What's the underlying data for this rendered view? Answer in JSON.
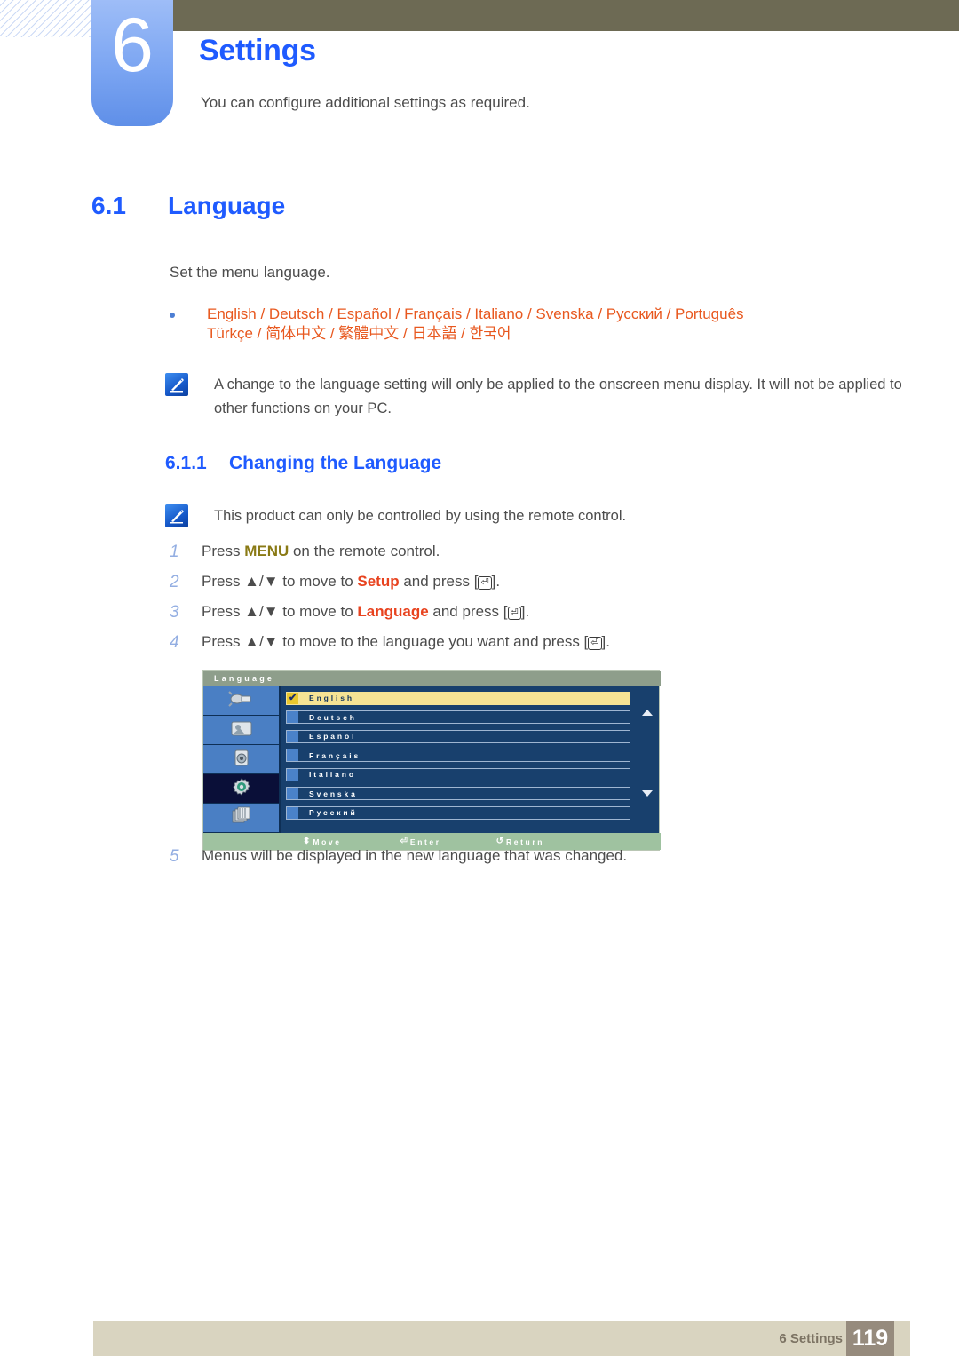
{
  "chapter": {
    "number": "6",
    "title": "Settings",
    "subtitle": "You can configure additional settings as required."
  },
  "section": {
    "number": "6.1",
    "title": "Language",
    "intro": "Set the menu language."
  },
  "language_bullet": {
    "line1": "English / Deutsch / Español / Français / Italiano / Svenska / Русский / Português",
    "line2": "Türkçe / 简体中文 / 繁體中文 / 日本語 / 한국어"
  },
  "notes": {
    "language_note": "A change to the language setting will only be applied to the onscreen menu display. It will not be applied to other functions on your PC.",
    "remote_note": "This product can only be controlled by using the remote control."
  },
  "subsection": {
    "number": "6.1.1",
    "title": "Changing the Language"
  },
  "steps": [
    {
      "num": "1",
      "pre": "Press ",
      "kw": "MENU",
      "kw_style": "menu",
      "post": " on the remote control.",
      "has_enter": false
    },
    {
      "num": "2",
      "pre": "Press ▲/▼ to move to ",
      "kw": "Setup",
      "kw_style": "orange",
      "post": " and press [",
      "has_enter": true,
      "tail": "]."
    },
    {
      "num": "3",
      "pre": "Press ▲/▼ to move to ",
      "kw": "Language",
      "kw_style": "orange",
      "post": " and press [",
      "has_enter": true,
      "tail": "]."
    },
    {
      "num": "4",
      "pre": "Press ▲/▼ to move to the language you want and press [",
      "kw": "",
      "kw_style": "",
      "post": "",
      "has_enter": true,
      "tail": "]."
    }
  ],
  "step5": {
    "num": "5",
    "text": "Menus will be displayed in the new language that was changed."
  },
  "osd": {
    "title": "Language",
    "sidebar_icons": [
      "input-connector-icon",
      "picture-icon",
      "sound-speaker-icon",
      "setup-gear-icon",
      "multi-control-icon"
    ],
    "selected_sidebar_index": 3,
    "options": [
      {
        "label": "English",
        "selected": true,
        "check": "✔"
      },
      {
        "label": "Deutsch",
        "selected": false,
        "check": ""
      },
      {
        "label": "Español",
        "selected": false,
        "check": ""
      },
      {
        "label": "Français",
        "selected": false,
        "check": ""
      },
      {
        "label": "Italiano",
        "selected": false,
        "check": ""
      },
      {
        "label": "Svenska",
        "selected": false,
        "check": ""
      },
      {
        "label": "Русский",
        "selected": false,
        "check": ""
      }
    ],
    "footer": {
      "move": "Move",
      "move_glyph": "⬍",
      "enter": "Enter",
      "enter_glyph": "⏎",
      "return": "Return",
      "return_glyph": "↺"
    }
  },
  "page_footer": {
    "label": "6 Settings",
    "page": "119"
  },
  "colors": {
    "heading_blue": "#1f5bff",
    "orange": "#e8581f",
    "keyword_orange": "#e8431f",
    "menu_gold": "#8a7a15",
    "olive_bar": "#6d6a54",
    "tab_blue": "#7ba5f2",
    "footer_bg": "#d9d4c0",
    "page_box": "#968b7d",
    "osd_navy": "#18406d",
    "osd_highlight": "#f5e394",
    "osd_footer_green": "#9fc2a0",
    "osd_title_bar": "#8e9e8b"
  }
}
